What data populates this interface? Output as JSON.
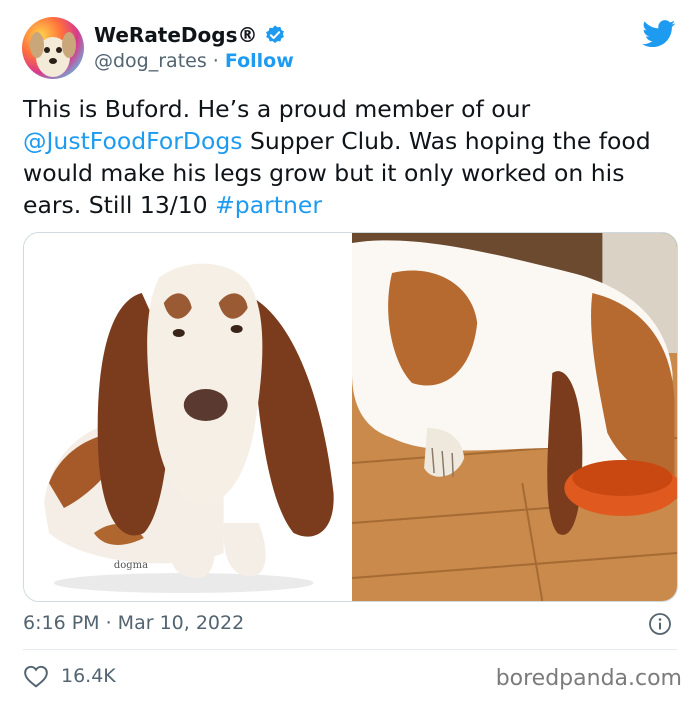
{
  "author": {
    "name": "WeRateDogs®",
    "handle": "@dog_rates",
    "separator": " · ",
    "follow_label": "Follow"
  },
  "tweet": {
    "text_intro": "This is Buford. He’s a proud member of our ",
    "mention": "@JustFoodForDogs",
    "text_body": " Supper Club. Was hoping the food would make his legs grow but it only worked on his ears. Still 13/10 ",
    "hashtag": "#partner"
  },
  "photo_left": {
    "watermark_text": "dogma"
  },
  "meta": {
    "timestamp": "6:16 PM · Mar 10, 2022",
    "likes": "16.4K"
  },
  "watermark": "boredpanda.com",
  "icons": {
    "verified": "verified-badge-icon",
    "brand": "twitter-bird-icon",
    "info": "info-icon",
    "like": "heart-icon"
  },
  "colors": {
    "accent": "#1d9bf0",
    "text": "#0f1419",
    "muted": "#536471"
  }
}
